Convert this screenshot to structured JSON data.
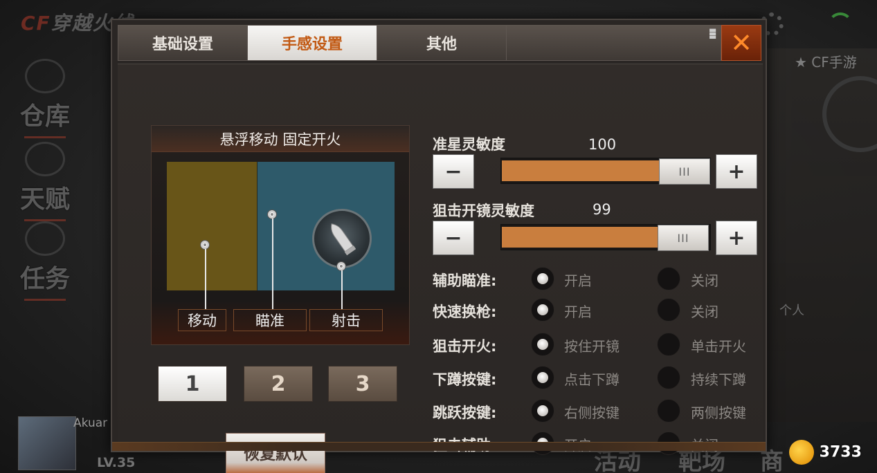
{
  "background": {
    "logo_text": "穿越火线",
    "nav_items": [
      "仓库",
      "天赋",
      "任务"
    ],
    "right_panel_title": "CF手游",
    "right_panel_person": "个人",
    "player_name": "Akuar",
    "player_level": "LV.35",
    "bottom_items": [
      "活动",
      "靶场",
      "商"
    ],
    "brand": "3733"
  },
  "tabs": [
    {
      "label": "基础设置",
      "active": false
    },
    {
      "label": "手感设置",
      "active": true
    },
    {
      "label": "其他",
      "active": false
    }
  ],
  "close_label": "✕",
  "preview": {
    "title": "悬浮移动 固定开火",
    "zones": [
      "移动",
      "瞄准",
      "射击"
    ]
  },
  "layouts": [
    {
      "label": "1",
      "active": true
    },
    {
      "label": "2",
      "active": false
    },
    {
      "label": "3",
      "active": false
    }
  ],
  "reset_label": "恢复默认",
  "sensitivity": [
    {
      "label": "准星灵敏度",
      "value": "100",
      "fraction": 1.0
    },
    {
      "label": "狙击开镜灵敏度",
      "value": "99",
      "fraction": 0.99
    }
  ],
  "step": {
    "minus": "−",
    "plus": "+"
  },
  "slider_grip": "III",
  "options": [
    {
      "label": "辅助瞄准:",
      "opt_a": "开启",
      "opt_b": "关闭",
      "selected": "a"
    },
    {
      "label": "快速换枪:",
      "opt_a": "开启",
      "opt_b": "关闭",
      "selected": "a"
    },
    {
      "label": "狙击开火:",
      "opt_a": "按住开镜",
      "opt_b": "单击开火",
      "selected": "a"
    },
    {
      "label": "下蹲按键:",
      "opt_a": "点击下蹲",
      "opt_b": "持续下蹲",
      "selected": "a"
    },
    {
      "label": "跳跃按键:",
      "opt_a": "右侧按键",
      "opt_b": "两侧按键",
      "selected": "a"
    },
    {
      "label": "狙击辅助:",
      "opt_a": "开启",
      "opt_b": "关闭",
      "selected": "a"
    }
  ],
  "colors": {
    "accent_orange": "#c97e3e",
    "move_zone": "#685518",
    "aim_zone": "#2e5a6a",
    "close_button": "#9a3a12",
    "active_tab_text": "#c25a14"
  }
}
